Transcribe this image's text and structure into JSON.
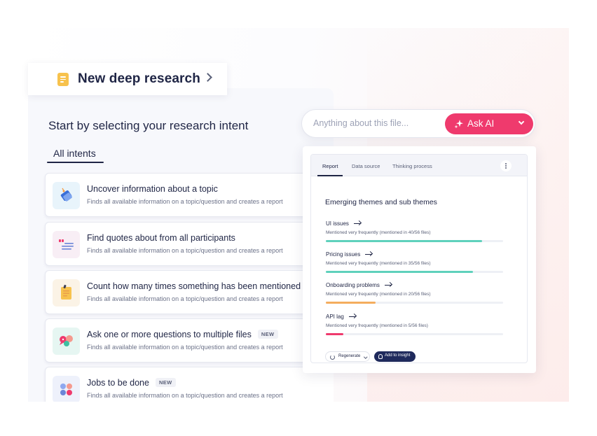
{
  "header": {
    "title": "New deep research",
    "icon": "document-icon"
  },
  "panel": {
    "title": "Start by selecting your research intent",
    "tab": "All intents",
    "intents": [
      {
        "title": "Uncover information about a topic",
        "desc": "Finds all available information on a topic/question and creates a report",
        "icon": "tag-icon"
      },
      {
        "title": "Find quotes about from all participants",
        "desc": "Finds all available information on a topic/question and creates a report",
        "icon": "quote-icon"
      },
      {
        "title": "Count how many times something has been mentioned",
        "desc": "Finds all available information on a topic/question and creates a report",
        "icon": "note-icon"
      },
      {
        "title": "Ask one or more questions to multiple files",
        "desc": "Finds all available information on a topic/question and creates a report",
        "badge": "NEW",
        "icon": "chat-bubbles-icon"
      },
      {
        "title": "Jobs to be done",
        "desc": "Finds all available information on a topic/question and creates a report",
        "badge": "NEW",
        "icon": "dots-icon"
      }
    ]
  },
  "search": {
    "placeholder": "Anything about this file...",
    "ask_label": "Ask AI"
  },
  "report": {
    "tabs": [
      "Report",
      "Data source",
      "Thinking process"
    ],
    "title": "Emerging themes and sub themes",
    "themes": [
      {
        "name": "UI issues",
        "meta": "Mentioned very frequently (mentioned in 40/56 files)",
        "progress": 0.88,
        "color": "#5fd1bc"
      },
      {
        "name": "Pricing issues",
        "meta": "Mentioned very frequently (mentioned in 35/56 files)",
        "progress": 0.83,
        "color": "#5fd1bc"
      },
      {
        "name": "Onboarding problems",
        "meta": "Mentioned very frequently (mentioned in 20/56 files)",
        "progress": 0.28,
        "color": "#f4ad5e"
      },
      {
        "name": "API lag",
        "meta": "Mentioned very frequently (mentioned in 5/56 files)",
        "progress": 0.1,
        "color": "#ef3a6d"
      }
    ],
    "regenerate_label": "Regenerate",
    "insight_label": "Add to insight"
  },
  "colors": {
    "accent": "#ef3a6d",
    "navy": "#1f2a5c",
    "teal": "#5fd1bc",
    "amber": "#f4ad5e"
  }
}
